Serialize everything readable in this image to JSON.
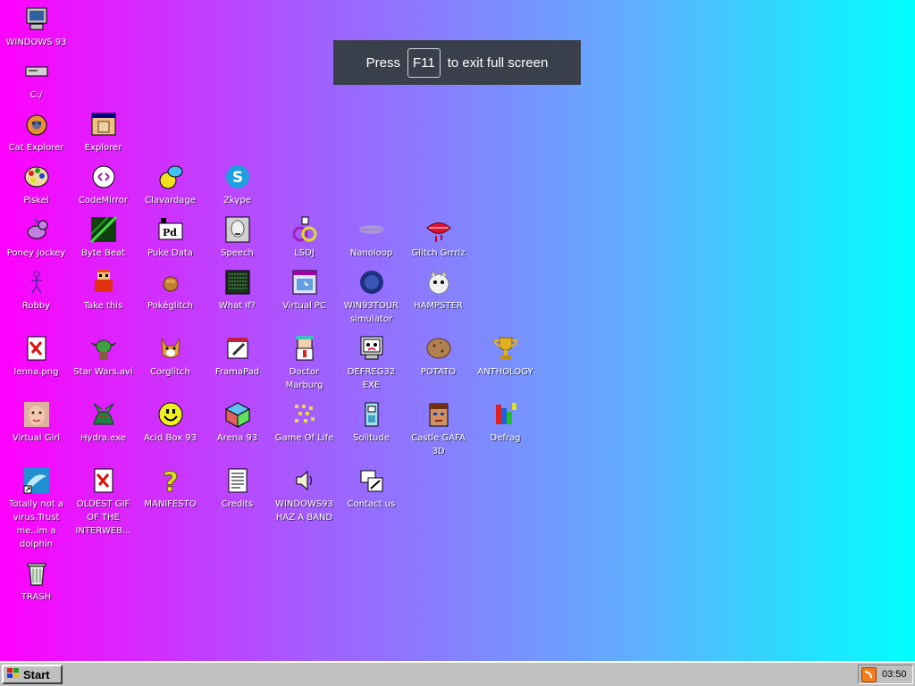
{
  "banner": {
    "pre": "Press",
    "key": "F11",
    "post": "to exit full screen"
  },
  "taskbar": {
    "start_label": "Start",
    "clock": "03:50"
  },
  "desktop": {
    "icons": [
      {
        "label": "WINDOWS 93",
        "icon": "computer-icon"
      },
      {
        "label": "C:/",
        "icon": "drive-icon"
      },
      {
        "label": "Cat Explorer",
        "icon": "cat-icon"
      },
      {
        "label": "Explorer",
        "icon": "window-icon"
      },
      {
        "label": "Piskel",
        "icon": "palette-icon"
      },
      {
        "label": "CodeMirror",
        "icon": "code-icon"
      },
      {
        "label": "Clavardage",
        "icon": "chat-icon"
      },
      {
        "label": "Zkype",
        "icon": "zkype-icon"
      },
      {
        "label": "Poney Jockey",
        "icon": "pony-icon"
      },
      {
        "label": "Byte Beat",
        "icon": "bytebeat-icon"
      },
      {
        "label": "Puke Data",
        "icon": "puredata-icon"
      },
      {
        "label": "Speech",
        "icon": "speech-icon"
      },
      {
        "label": "LSDJ",
        "icon": "lsdj-icon"
      },
      {
        "label": "Nanoloop",
        "icon": "nanoloop-icon"
      },
      {
        "label": "Glitch Grrrlz",
        "icon": "lips-icon"
      },
      {
        "label": "Robby",
        "icon": "robby-icon"
      },
      {
        "label": "Take this",
        "icon": "take-this-icon"
      },
      {
        "label": "Pokéglitch",
        "icon": "pokeglitch-icon"
      },
      {
        "label": "What If?",
        "icon": "terminal-icon"
      },
      {
        "label": "Virtual PC",
        "icon": "virtual-pc-icon"
      },
      {
        "label": "WIN93TOUR simulator",
        "icon": "tour-icon"
      },
      {
        "label": "HAMPSTER",
        "icon": "hampster-icon"
      },
      {
        "label": "lenna.png",
        "icon": "image-file-icon"
      },
      {
        "label": "Star Wars.avi",
        "icon": "yoda-icon"
      },
      {
        "label": "Corglitch",
        "icon": "corgi-icon"
      },
      {
        "label": "FramaPad",
        "icon": "framapad-icon"
      },
      {
        "label": "Doctor Marburg",
        "icon": "doctor-icon"
      },
      {
        "label": "DEFREG32 EXE",
        "icon": "defreg-icon"
      },
      {
        "label": "POTATO",
        "icon": "potato-icon"
      },
      {
        "label": "ANTHOLOGY",
        "icon": "trophy-icon"
      },
      {
        "label": "Virtual Girl",
        "icon": "face-icon"
      },
      {
        "label": "Hydra.exe",
        "icon": "hydra-icon"
      },
      {
        "label": "Acid Box 93",
        "icon": "smiley-icon"
      },
      {
        "label": "Arena 93",
        "icon": "cube-icon"
      },
      {
        "label": "Game Of Life",
        "icon": "game-of-life-icon"
      },
      {
        "label": "Solitude",
        "icon": "solitude-icon"
      },
      {
        "label": "Castle GAFA 3D",
        "icon": "castle-face-icon"
      },
      {
        "label": "Defrag",
        "icon": "defrag-icon"
      },
      {
        "label": "Totally not a virus.Trust me..im a dolphin",
        "icon": "dolphin-icon"
      },
      {
        "label": "OLDEST GIF OF THE INTERWEB...",
        "icon": "gif-file-icon"
      },
      {
        "label": "MANIFESTO",
        "icon": "question-icon"
      },
      {
        "label": "Credits",
        "icon": "document-icon"
      },
      {
        "label": "WINDOWS93 HAZ A BAND",
        "icon": "speaker-icon"
      },
      {
        "label": "Contact us",
        "icon": "contact-icon"
      },
      {
        "label": "TRASH",
        "icon": "trash-icon"
      }
    ]
  }
}
